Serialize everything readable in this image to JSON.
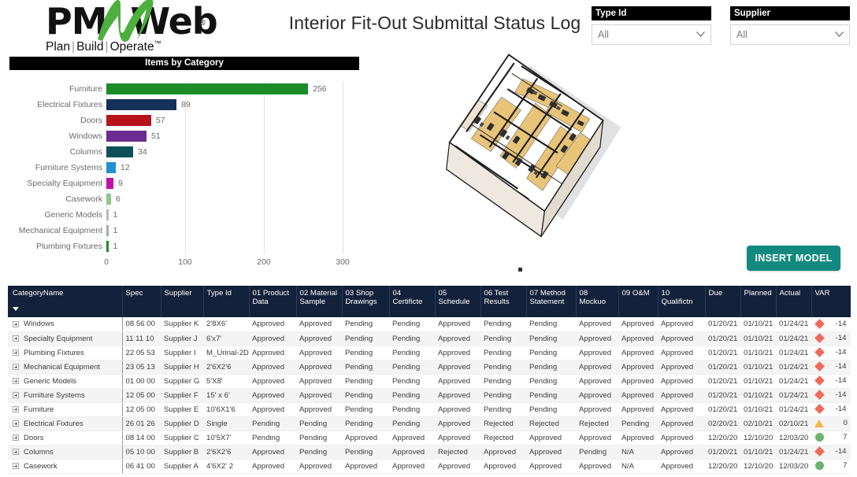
{
  "header": {
    "logo": {
      "pm": "PM",
      "web": "Web",
      "registered": "®",
      "tagline_plan": "Plan",
      "tagline_build": "Build",
      "tagline_operate": "Operate",
      "tm": "™"
    },
    "title": "Interior Fit-Out Submittal Status Log"
  },
  "slicers": [
    {
      "name": "type-id",
      "label": "Type Id",
      "value": "All",
      "icon": "chevron-down-icon"
    },
    {
      "name": "supplier",
      "label": "Supplier",
      "value": "All",
      "icon": "chevron-down-icon"
    }
  ],
  "insert_model_button": {
    "label": "INSERT MODEL",
    "color": "#12897e"
  },
  "model": {
    "name": "bim-floor-plan-model"
  },
  "chart_data": {
    "type": "bar",
    "orientation": "horizontal",
    "title": "Items by Category",
    "xlabel": "",
    "ylabel": "",
    "xlim": [
      0,
      300
    ],
    "xticks": [
      0,
      100,
      200,
      300
    ],
    "grid": true,
    "legend": "none",
    "categories": [
      "Furniture",
      "Electrical Fixtures",
      "Doors",
      "Windows",
      "Columns",
      "Furniture Systems",
      "Specialty Equipment",
      "Casework",
      "Generic Models",
      "Mechanical Equipment",
      "Plumbing Fixtures"
    ],
    "values": [
      256,
      89,
      57,
      51,
      34,
      12,
      9,
      6,
      1,
      1,
      1
    ],
    "colors": [
      "#1a8c28",
      "#16305c",
      "#b5121b",
      "#6c2b8e",
      "#0f5058",
      "#1f8fd6",
      "#c40fa8",
      "#8cc98c",
      "#b9b9c9",
      "#9fb0a8",
      "#1a8c28"
    ]
  },
  "table": {
    "columns": [
      "CategoryName",
      "Spec",
      "Supplier",
      "Type Id",
      "01 Product Data",
      "02 Material Sample",
      "03 Shop Drawings",
      "04 Certificte",
      "05 Schedule",
      "06 Test Results",
      "07 Method Statement",
      "08 Mockuo",
      "09 O&M",
      "10 Qualifictn",
      "Due",
      "Planned",
      "Actual",
      "VAR"
    ],
    "sort_column": "CategoryName",
    "rows": [
      {
        "category": "Windows",
        "spec": "08 56 00",
        "supplier": "Supplier K",
        "type_id": "2'8X6'",
        "c01": "Approved",
        "c02": "Approved",
        "c03": "Pending",
        "c04": "Pending",
        "c05": "Approved",
        "c06": "Pending",
        "c07": "Pending",
        "c08": "Approved",
        "c09": "Approved",
        "c10": "Approved",
        "due": "01/20/21",
        "planned": "01/10/21",
        "actual": "01/24/21",
        "var": "-14",
        "indicator": "red-diamond"
      },
      {
        "category": "Specialty Equipment",
        "spec": "11 11 10",
        "supplier": "Supplier J",
        "type_id": "6'x7'",
        "c01": "Approved",
        "c02": "Approved",
        "c03": "Pending",
        "c04": "Pending",
        "c05": "Approved",
        "c06": "Pending",
        "c07": "Pending",
        "c08": "Approved",
        "c09": "Approved",
        "c10": "Approved",
        "due": "01/20/21",
        "planned": "01/10/21",
        "actual": "01/24/21",
        "var": "-14",
        "indicator": "red-diamond"
      },
      {
        "category": "Plumbing Fixtures",
        "spec": "22 05 53",
        "supplier": "Supplier I",
        "type_id": "M_Urinal-2D",
        "c01": "Approved",
        "c02": "Approved",
        "c03": "Pending",
        "c04": "Pending",
        "c05": "Approved",
        "c06": "Pending",
        "c07": "Pending",
        "c08": "Approved",
        "c09": "Approved",
        "c10": "Approved",
        "due": "01/20/21",
        "planned": "01/10/21",
        "actual": "01/24/21",
        "var": "-14",
        "indicator": "red-diamond"
      },
      {
        "category": "Mechanical Equipment",
        "spec": "23 05 13",
        "supplier": "Supplier H",
        "type_id": "2'6X2'6",
        "c01": "Approved",
        "c02": "Approved",
        "c03": "Pending",
        "c04": "Pending",
        "c05": "Approved",
        "c06": "Pending",
        "c07": "Pending",
        "c08": "Approved",
        "c09": "Approved",
        "c10": "Approved",
        "due": "01/20/21",
        "planned": "01/10/21",
        "actual": "01/24/21",
        "var": "-14",
        "indicator": "red-diamond"
      },
      {
        "category": "Generic Models",
        "spec": "01 00 00",
        "supplier": "Supplier G",
        "type_id": "5'X8'",
        "c01": "Approved",
        "c02": "Approved",
        "c03": "Pending",
        "c04": "Pending",
        "c05": "Approved",
        "c06": "Pending",
        "c07": "Pending",
        "c08": "Approved",
        "c09": "Approved",
        "c10": "Approved",
        "due": "01/20/21",
        "planned": "01/10/21",
        "actual": "01/24/21",
        "var": "-14",
        "indicator": "red-diamond"
      },
      {
        "category": "Furniture Systems",
        "spec": "12 05 00",
        "supplier": "Supplier F",
        "type_id": "15' x 6'",
        "c01": "Approved",
        "c02": "Approved",
        "c03": "Pending",
        "c04": "Pending",
        "c05": "Approved",
        "c06": "Pending",
        "c07": "Pending",
        "c08": "Approved",
        "c09": "Approved",
        "c10": "Approved",
        "due": "01/20/21",
        "planned": "01/10/21",
        "actual": "01/24/21",
        "var": "-14",
        "indicator": "red-diamond"
      },
      {
        "category": "Furniture",
        "spec": "12 05 00",
        "supplier": "Supplier E",
        "type_id": "10'6X1'6",
        "c01": "Approved",
        "c02": "Approved",
        "c03": "Pending",
        "c04": "Pending",
        "c05": "Approved",
        "c06": "Pending",
        "c07": "Pending",
        "c08": "Approved",
        "c09": "Approved",
        "c10": "Approved",
        "due": "01/20/21",
        "planned": "01/10/21",
        "actual": "01/24/21",
        "var": "-14",
        "indicator": "red-diamond"
      },
      {
        "category": "Electrical Fixtures",
        "spec": "26 01 26",
        "supplier": "Supplier D",
        "type_id": "Single",
        "c01": "Pending",
        "c02": "Pending",
        "c03": "Pending",
        "c04": "Pending",
        "c05": "Approved",
        "c06": "Rejected",
        "c07": "Rejected",
        "c08": "Rejected",
        "c09": "Pending",
        "c10": "Approved",
        "due": "02/20/21",
        "planned": "02/10/21",
        "actual": "02/10/21",
        "var": "0",
        "indicator": "yellow-triangle"
      },
      {
        "category": "Doors",
        "spec": "08 14 00",
        "supplier": "Supplier C",
        "type_id": "10'5X7'",
        "c01": "Pending",
        "c02": "Pending",
        "c03": "Approved",
        "c04": "Approved",
        "c05": "Approved",
        "c06": "Rejected",
        "c07": "Approved",
        "c08": "Approved",
        "c09": "Approved",
        "c10": "Approved",
        "due": "12/20/20",
        "planned": "12/10/20",
        "actual": "12/03/20",
        "var": "7",
        "indicator": "green-circle"
      },
      {
        "category": "Columns",
        "spec": "05 10 00",
        "supplier": "Supplier B",
        "type_id": "2'6X2'6",
        "c01": "Approved",
        "c02": "Pending",
        "c03": "Pending",
        "c04": "Approved",
        "c05": "Rejected",
        "c06": "Approved",
        "c07": "Approved",
        "c08": "Pending",
        "c09": "N/A",
        "c10": "Approved",
        "due": "01/20/21",
        "planned": "01/10/21",
        "actual": "01/24/21",
        "var": "-14",
        "indicator": "red-diamond"
      },
      {
        "category": "Casework",
        "spec": "06 41 00",
        "supplier": "Supplier A",
        "type_id": "4'6X2' 2",
        "c01": "Approved",
        "c02": "Approved",
        "c03": "Approved",
        "c04": "Approved",
        "c05": "Approved",
        "c06": "Approved",
        "c07": "Approved",
        "c08": "Approved",
        "c09": "N/A",
        "c10": "Approved",
        "due": "12/20/20",
        "planned": "12/10/20",
        "actual": "12/03/20",
        "var": "7",
        "indicator": "green-circle"
      }
    ]
  }
}
